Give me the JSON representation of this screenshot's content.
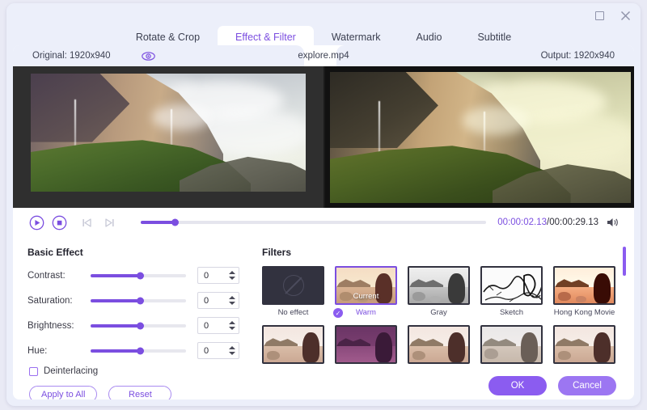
{
  "window": {
    "maximize_label": "Maximize",
    "close_label": "Close"
  },
  "tabs": [
    {
      "label": "Rotate & Crop",
      "active": false
    },
    {
      "label": "Effect & Filter",
      "active": true
    },
    {
      "label": "Watermark",
      "active": false
    },
    {
      "label": "Audio",
      "active": false
    },
    {
      "label": "Subtitle",
      "active": false
    }
  ],
  "preview": {
    "original_label": "Original: 1920x940",
    "output_label": "Output: 1920x940",
    "filename": "explore.mp4",
    "eye_icon": "eye-icon"
  },
  "player": {
    "play_icon": "play-icon",
    "stop_icon": "stop-icon",
    "prev_icon": "previous-frame-icon",
    "next_icon": "next-frame-icon",
    "current_time": "00:00:02.13",
    "total_time": "/00:00:29.13",
    "volume_icon": "volume-icon",
    "seek_percent": 10
  },
  "basic_effect": {
    "title": "Basic Effect",
    "sliders": [
      {
        "label": "Contrast:",
        "value": "0",
        "percent": 52
      },
      {
        "label": "Saturation:",
        "value": "0",
        "percent": 52
      },
      {
        "label": "Brightness:",
        "value": "0",
        "percent": 52
      },
      {
        "label": "Hue:",
        "value": "0",
        "percent": 52
      }
    ],
    "deinterlacing_label": "Deinterlacing",
    "deinterlacing_checked": false,
    "apply_all_label": "Apply to All",
    "reset_label": "Reset"
  },
  "filters": {
    "title": "Filters",
    "current_badge": "Current",
    "items": [
      {
        "label": "No effect",
        "selected": false,
        "style": "none"
      },
      {
        "label": "Warm",
        "selected": true,
        "style": "warm"
      },
      {
        "label": "Gray",
        "selected": false,
        "style": "gray"
      },
      {
        "label": "Sketch",
        "selected": false,
        "style": "sketch"
      },
      {
        "label": "Hong Kong Movie",
        "selected": false,
        "style": "hongkong"
      },
      {
        "label": "",
        "selected": false,
        "style": "plain"
      },
      {
        "label": "",
        "selected": false,
        "style": "purple"
      },
      {
        "label": "",
        "selected": false,
        "style": "plain"
      },
      {
        "label": "",
        "selected": false,
        "style": "faded"
      },
      {
        "label": "",
        "selected": false,
        "style": "plain"
      }
    ]
  },
  "footer": {
    "ok_label": "OK",
    "cancel_label": "Cancel"
  },
  "colors": {
    "accent": "#7b4ee0",
    "accent_light": "#8b5cf0",
    "panel_bg": "#eceffa",
    "card_bg": "#ffffff"
  }
}
